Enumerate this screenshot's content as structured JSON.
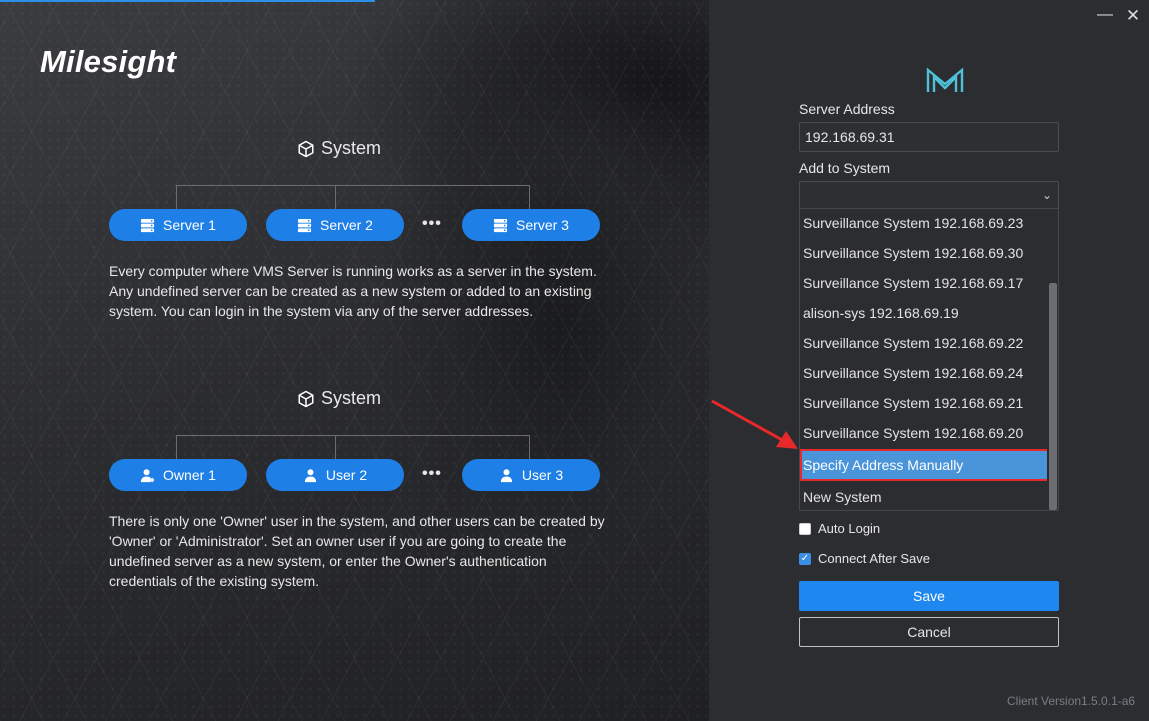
{
  "brand": {
    "logo_text": "Milesight"
  },
  "left": {
    "section1": {
      "title": "System",
      "nodes": [
        "Server 1",
        "Server 2",
        "Server 3"
      ],
      "ellipsis": "•••",
      "description": "Every computer where VMS Server is running works as a server in the system. Any undefined server can be created as a new system or added to an existing system. You can login in the system via any of the server addresses."
    },
    "section2": {
      "title": "System",
      "nodes": [
        "Owner 1",
        "User 2",
        "User 3"
      ],
      "ellipsis": "•••",
      "description": "There is only one 'Owner' user in the system, and other users can be created by 'Owner' or 'Administrator'. Set an owner user if you are going to create the undefined server as a new system, or enter the Owner's authentication credentials of the existing system."
    }
  },
  "window": {
    "minimize": "—",
    "close": "✕"
  },
  "form": {
    "server_address_label": "Server Address",
    "server_address_value": "192.168.69.31",
    "add_to_system_label": "Add to System",
    "add_to_system_value": "",
    "dropdown_options": [
      "Surveillance System 192.168.69.23",
      "Surveillance System 192.168.69.30",
      "Surveillance System 192.168.69.17",
      "alison-sys 192.168.69.19",
      "Surveillance System 192.168.69.22",
      "Surveillance System 192.168.69.24",
      "Surveillance System 192.168.69.21",
      "Surveillance System 192.168.69.20",
      "Specify Address Manually",
      "New System"
    ],
    "selected_option": "Specify Address Manually",
    "auto_login_label": "Auto Login",
    "auto_login_checked": false,
    "connect_after_save_label": "Connect After Save",
    "connect_after_save_checked": true,
    "save_label": "Save",
    "cancel_label": "Cancel"
  },
  "footer": {
    "version": "Client Version1.5.0.1-a6"
  },
  "colors": {
    "accent": "#1e88f0",
    "highlight_border": "#e8282a",
    "arrow": "#e8282a"
  }
}
